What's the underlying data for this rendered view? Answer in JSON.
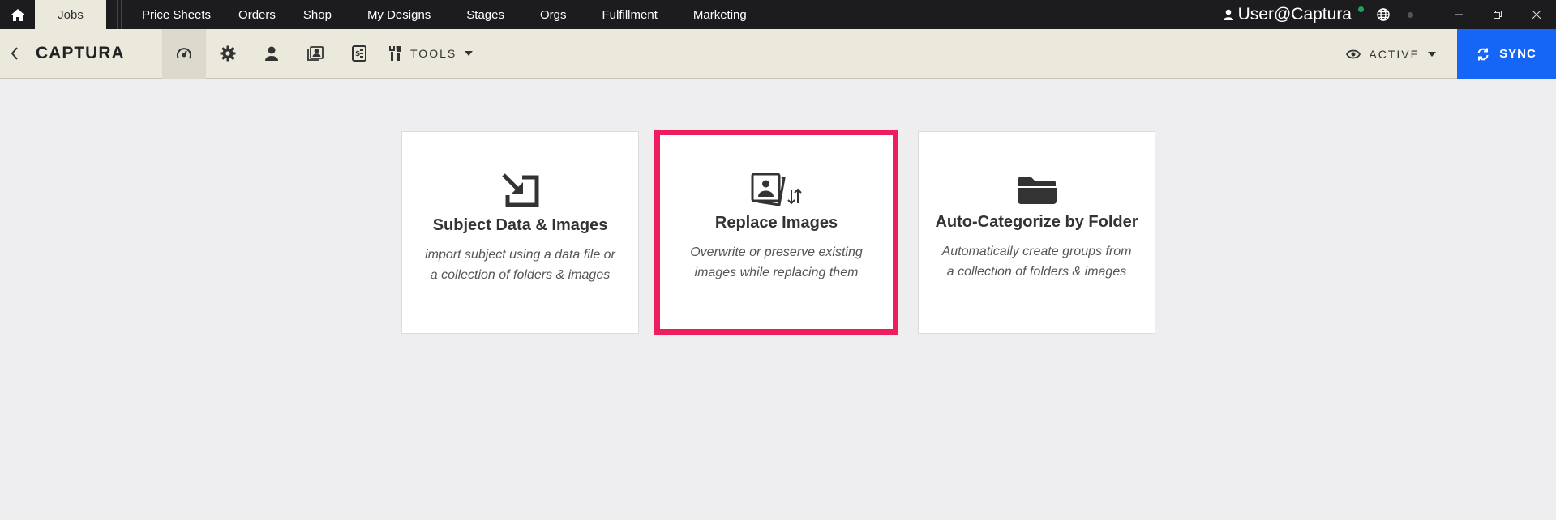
{
  "topnav": {
    "active_tab": "Jobs",
    "items": [
      "Price Sheets",
      "Orders",
      "Shop",
      "My Designs",
      "Stages",
      "Orgs",
      "Fulfillment",
      "Marketing"
    ],
    "user": "User@Captura"
  },
  "toolbar": {
    "brand": "CAPTURA",
    "tools_label": "TOOLS",
    "filter_label": "ACTIVE",
    "sync_label": "SYNC"
  },
  "cards": [
    {
      "title": "Subject Data & Images",
      "desc_line1": "import subject using a data file or",
      "desc_line2": "a collection of folders & images"
    },
    {
      "title": "Replace Images",
      "desc_line1": "Overwrite or preserve existing",
      "desc_line2": "images while replacing them"
    },
    {
      "title": "Auto-Categorize by Folder",
      "desc_line1": "Automatically create groups from",
      "desc_line2": "a collection of folders & images"
    }
  ],
  "colors": {
    "accent_sync": "#1565f7",
    "selected_border": "#ee1d5e",
    "toolbar_bg": "#ebe8dc",
    "topbar_bg": "#1c1c1e"
  }
}
